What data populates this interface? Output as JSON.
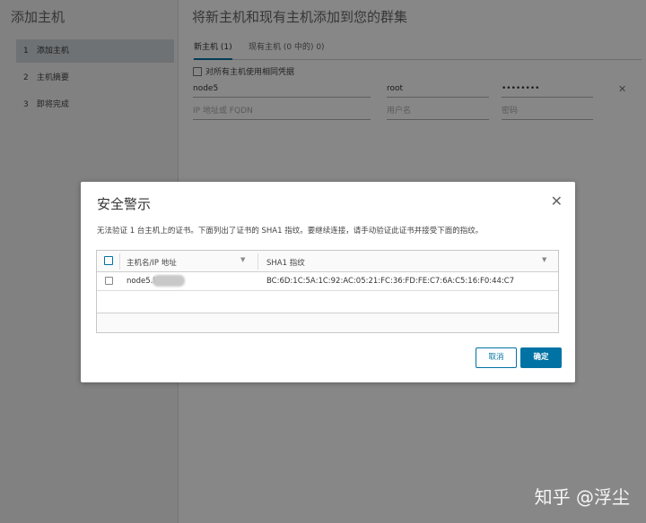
{
  "wizard": {
    "title": "添加主机",
    "steps": [
      {
        "num": "1",
        "label": "添加主机"
      },
      {
        "num": "2",
        "label": "主机摘要"
      },
      {
        "num": "3",
        "label": "即将完成"
      }
    ],
    "main_title": "将新主机和现有主机添加到您的群集",
    "tabs": [
      "新主机 (1)",
      "现有主机 (0 中的) 0)"
    ],
    "same_credentials_label": "对所有主机使用相同凭据",
    "host": {
      "hostname_value": "node5",
      "username_value": "root",
      "password_value": "••••••••",
      "hostname_placeholder": "IP 地址或 FQDN",
      "username_placeholder": "用户名",
      "password_placeholder": "密码"
    }
  },
  "dialog": {
    "title": "安全警示",
    "message": "无法验证 1 台主机上的证书。下面列出了证书的 SHA1 指纹。要继续连接，请手动验证此证书并接受下面的指纹。",
    "columns": [
      "主机名/IP 地址",
      "SHA1 指纹"
    ],
    "rows": [
      {
        "host": "node5.h",
        "sha1": "BC:6D:1C:5A:1C:92:AC:05:21:FC:36:FD:FE:C7:6A:C5:16:F0:44:C7"
      }
    ],
    "cancel_label": "取消",
    "ok_label": "确定"
  },
  "watermark": "知乎 @浮尘",
  "colors": {
    "accent": "#0072a3",
    "overlay": "rgba(0,0,0,0.47)"
  }
}
